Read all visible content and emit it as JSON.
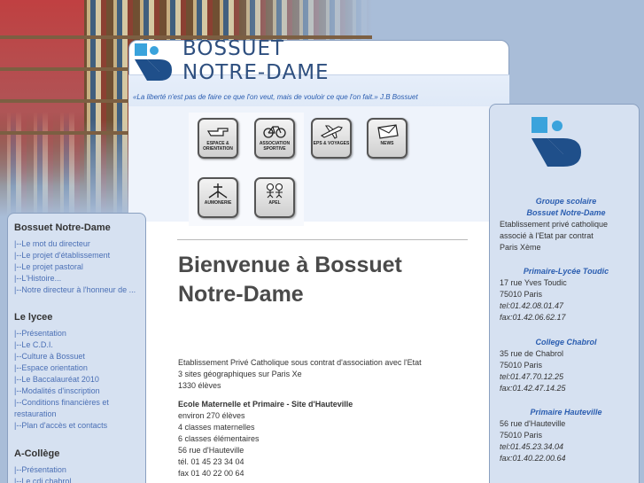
{
  "header": {
    "title_line1": "BOSSUET",
    "title_line2": "NOTRE-DAME",
    "quote": "«La liberté n'est pas de faire ce que l'on veut, mais de vouloir ce que l'on fait.»  J.B Bossuet",
    "logo_icon": "bossuet-bd-logo"
  },
  "icons": [
    {
      "label": "ESPACE & ORIENTATION",
      "icon": "pointing-hand-icon"
    },
    {
      "label": "ASSOCIATION SPORTIVE",
      "icon": "bicycle-icon"
    },
    {
      "label": "EPS & VOYAGES",
      "icon": "airplane-icon"
    },
    {
      "label": "NEWS",
      "icon": "envelope-icon"
    },
    {
      "label": "AUMONERIE",
      "icon": "cross-icon"
    },
    {
      "label": "APEL",
      "icon": "children-icon"
    }
  ],
  "main": {
    "welcome_title": "Bienvenue à Bossuet Notre-Dame",
    "lines": [
      "Etablissement Privé Catholique sous contrat d'association avec l'Etat",
      "3 sites géographiques sur Paris Xe",
      "1330 élèves"
    ],
    "section_title": "Ecole Maternelle et Primaire - Site d'Hauteville",
    "section_lines": [
      "environ 270 élèves",
      "4 classes maternelles",
      "6 classes élémentaires",
      "56 rue d'Hauteville",
      "tél. 01 45 23 34 04",
      "fax 01 40 22 00 64"
    ]
  },
  "left": {
    "sections": [
      {
        "title": "Bossuet Notre-Dame",
        "links": [
          "|--Le mot du directeur",
          "|--Le projet d'établissement",
          "|--Le projet pastoral",
          "|--L'Histoire...",
          "|--Notre directeur à l'honneur de ..."
        ]
      },
      {
        "title": "Le lycee",
        "links": [
          "|--Présentation",
          "|--Le C.D.I.",
          "|--Culture à Bossuet",
          "|--Espace orientation",
          "|--Le Baccalauréat 2010",
          "|--Modalités d'inscription",
          "|--Conditions financières et",
          "restauration",
          "|--Plan d'accès et contacts"
        ]
      },
      {
        "title": "A-Collège",
        "links": [
          "|--Présentation",
          "|--Le cdi chabrol"
        ]
      }
    ]
  },
  "right": {
    "groupe": {
      "title1": "Groupe scolaire",
      "title2": "Bossuet Notre-Dame",
      "lines": [
        "Etablissement privé catholique",
        "associé à l'Etat par contrat",
        "Paris Xème"
      ]
    },
    "sites": [
      {
        "title": "Primaire-Lycée Toudic",
        "lines": [
          "17 rue Yves Toudic",
          "75010 Paris",
          "tel:01.42.08.01.47",
          "fax:01.42.06.62.17"
        ]
      },
      {
        "title": "College Chabrol",
        "lines": [
          "35 rue de Chabrol",
          "75010 Paris",
          "tel:01.47.70.12.25",
          "fax:01.42.47.14.25"
        ]
      },
      {
        "title": "Primaire Hauteville",
        "lines": [
          "56 rue d'Hauteville",
          "75010 Paris",
          "tel:01.45.23.34.04",
          "fax:01.40.22.00.64"
        ]
      }
    ]
  },
  "colors": {
    "title_blue": "#2e4f7f",
    "link_blue": "#4a6fb5",
    "logo_cyan": "#3aa3dc",
    "logo_navy": "#1f4f8a",
    "background": "#a9bdd8"
  }
}
